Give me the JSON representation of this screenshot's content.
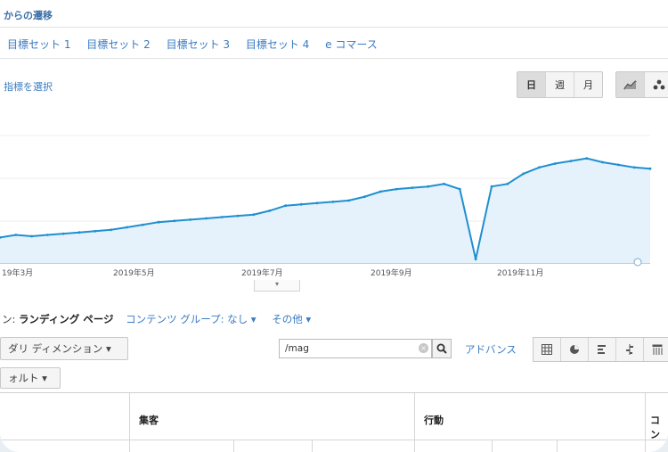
{
  "header": {
    "breadcrumb": "からの遷移"
  },
  "tabs": [
    "目標セット 1",
    "目標セット 2",
    "目標セット 3",
    "目標セット 4",
    "e コマース"
  ],
  "metric_selector": {
    "label": "指標を選択"
  },
  "granularity": {
    "day": "日",
    "week": "週",
    "month": "月",
    "active": "day"
  },
  "chart_type_toggle": {
    "line": "line-chart-icon",
    "motion": "motion-chart-icon"
  },
  "chart_data": {
    "type": "area",
    "title": "",
    "xlabel": "",
    "ylabel": "",
    "x_tick_labels": [
      "19年3月",
      "2019年5月",
      "2019年7月",
      "2019年9月",
      "2019年11月"
    ],
    "series": [
      {
        "values": [
          20,
          22,
          21,
          22,
          23,
          24,
          25,
          26,
          28,
          30,
          32,
          33,
          34,
          35,
          36,
          37,
          38,
          41,
          45,
          46,
          47,
          48,
          49,
          52,
          56,
          58,
          59,
          60,
          62,
          58,
          3,
          60,
          62,
          70,
          75,
          78,
          80,
          82,
          79,
          77,
          75,
          74
        ]
      }
    ],
    "color": "#1f8fd0",
    "fill": "#e5f2fb",
    "grid": true,
    "ylim": [
      0,
      100
    ]
  },
  "dimension_bar": {
    "prefix": "ン:",
    "primary": "ランディング ページ",
    "content_group": "コンテンツ グループ: なし ▾",
    "other": "その他 ▾"
  },
  "secondary_dimension": {
    "label": "ダリ ディメンション ▾"
  },
  "sort": {
    "label": "ォルト ▾"
  },
  "search": {
    "value": "/mag",
    "advanced": "アドバンス"
  },
  "view_icons": [
    "grid-view-icon",
    "pie-view-icon",
    "bar-view-icon",
    "comparison-view-icon",
    "pivot-view-icon"
  ],
  "table": {
    "headers": [
      "集客",
      "行動",
      "コン"
    ]
  }
}
